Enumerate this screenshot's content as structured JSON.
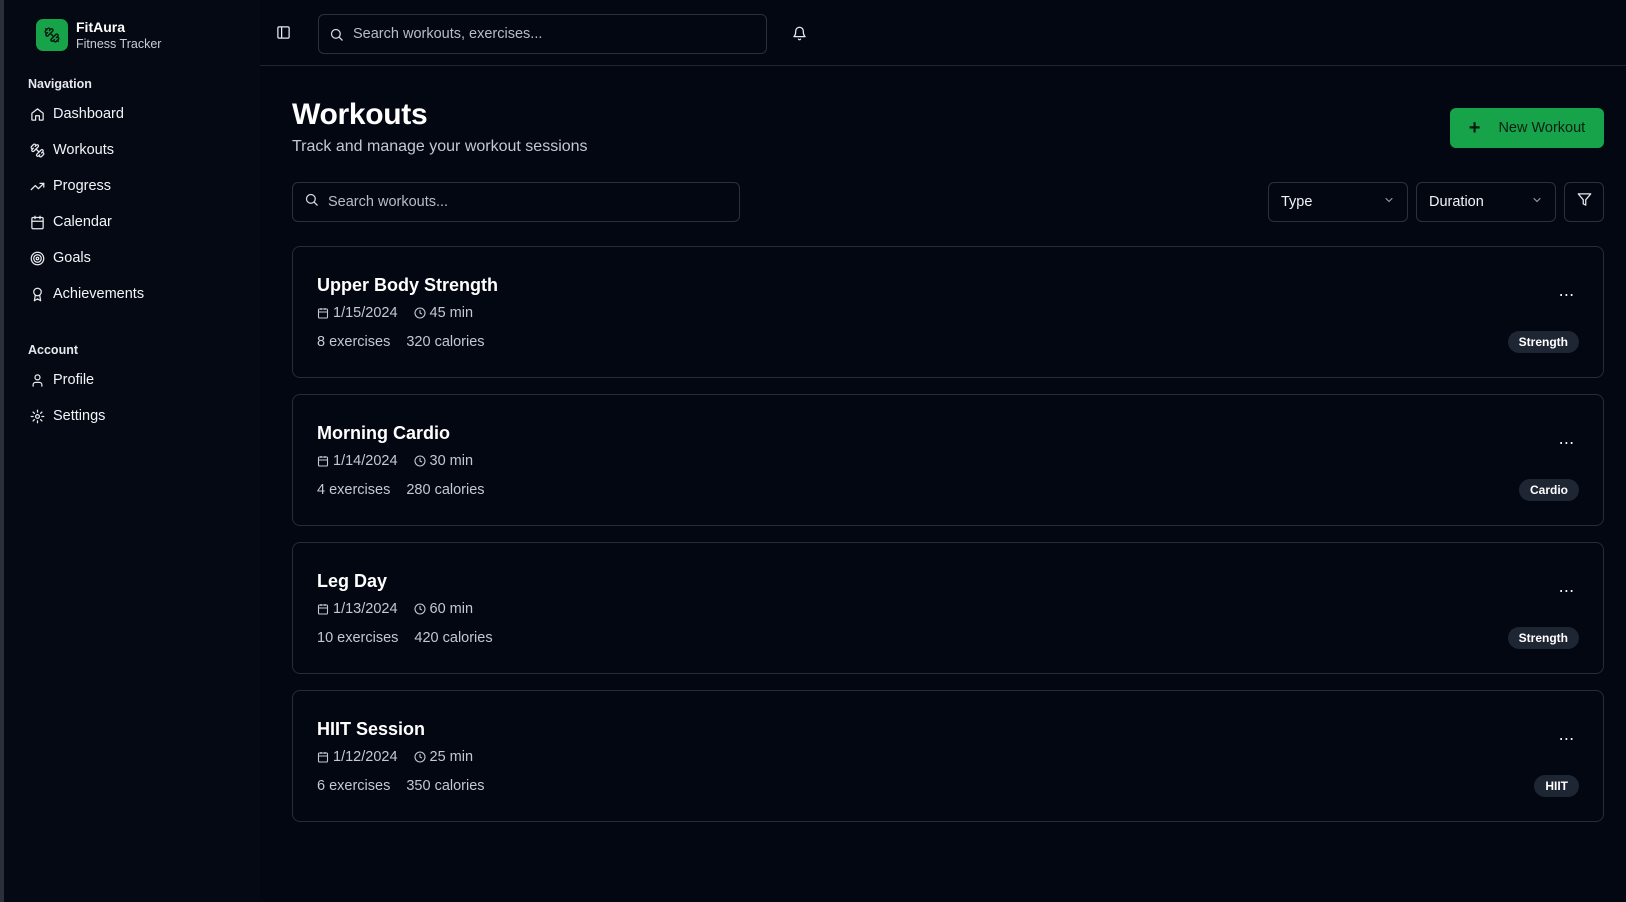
{
  "brand": {
    "name": "FitAura",
    "subtitle": "Fitness Tracker",
    "accent": "#16a34a"
  },
  "sidebar": {
    "navigation_heading": "Navigation",
    "items": [
      {
        "label": "Dashboard",
        "icon": "home-icon"
      },
      {
        "label": "Workouts",
        "icon": "dumbbell-icon"
      },
      {
        "label": "Progress",
        "icon": "trending-up-icon"
      },
      {
        "label": "Calendar",
        "icon": "calendar-icon"
      },
      {
        "label": "Goals",
        "icon": "target-icon"
      },
      {
        "label": "Achievements",
        "icon": "award-icon"
      }
    ],
    "account_heading": "Account",
    "account_items": [
      {
        "label": "Profile",
        "icon": "user-icon"
      },
      {
        "label": "Settings",
        "icon": "gear-icon"
      }
    ]
  },
  "topbar": {
    "search_placeholder": "Search workouts, exercises..."
  },
  "page": {
    "title": "Workouts",
    "subtitle": "Track and manage your workout sessions",
    "new_button": "New Workout",
    "search_placeholder": "Search workouts...",
    "type_select": "Type",
    "duration_select": "Duration"
  },
  "workouts": [
    {
      "title": "Upper Body Strength",
      "date": "1/15/2024",
      "duration": "45 min",
      "exercises": "8 exercises",
      "calories": "320 calories",
      "tag": "Strength"
    },
    {
      "title": "Morning Cardio",
      "date": "1/14/2024",
      "duration": "30 min",
      "exercises": "4 exercises",
      "calories": "280 calories",
      "tag": "Cardio"
    },
    {
      "title": "Leg Day",
      "date": "1/13/2024",
      "duration": "60 min",
      "exercises": "10 exercises",
      "calories": "420 calories",
      "tag": "Strength"
    },
    {
      "title": "HIIT Session",
      "date": "1/12/2024",
      "duration": "25 min",
      "exercises": "6 exercises",
      "calories": "350 calories",
      "tag": "HIIT"
    }
  ]
}
